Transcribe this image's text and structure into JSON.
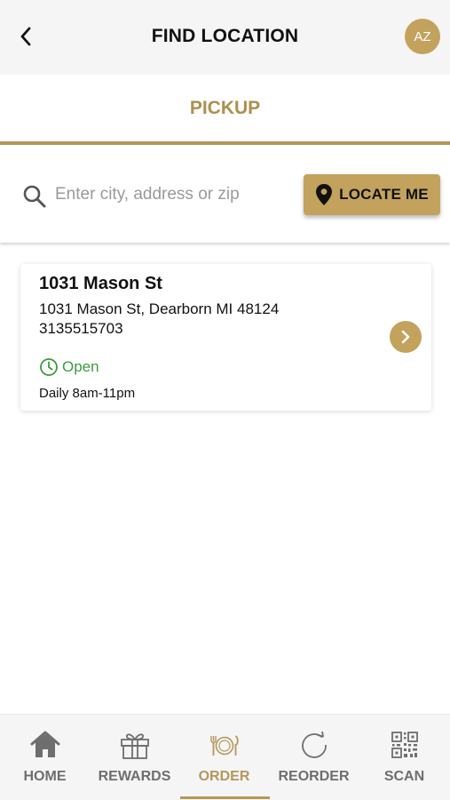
{
  "header": {
    "title": "FIND LOCATION",
    "avatar_initials": "AZ",
    "back_icon": "chevron-left-icon"
  },
  "tabs": {
    "pickup_label": "PICKUP"
  },
  "search": {
    "placeholder": "Enter city, address or zip",
    "value": "",
    "locate_label": "LOCATE ME"
  },
  "locations": [
    {
      "name": "1031 Mason St",
      "address": "1031 Mason St, Dearborn MI 48124",
      "phone": "3135515703",
      "status": "Open",
      "hours": "Daily 8am-11pm"
    }
  ],
  "bottom_nav": {
    "items": [
      {
        "label": "HOME",
        "icon": "home-icon",
        "active": false
      },
      {
        "label": "REWARDS",
        "icon": "gift-icon",
        "active": false
      },
      {
        "label": "ORDER",
        "icon": "plate-cutlery-icon",
        "active": true
      },
      {
        "label": "REORDER",
        "icon": "refresh-icon",
        "active": false
      },
      {
        "label": "SCAN",
        "icon": "qr-code-icon",
        "active": false
      }
    ]
  },
  "colors": {
    "accent": "#c3a25e",
    "accent_text": "#ad8f4e",
    "open_status": "#3d9a3d",
    "nav_inactive": "#6e6e6e"
  }
}
